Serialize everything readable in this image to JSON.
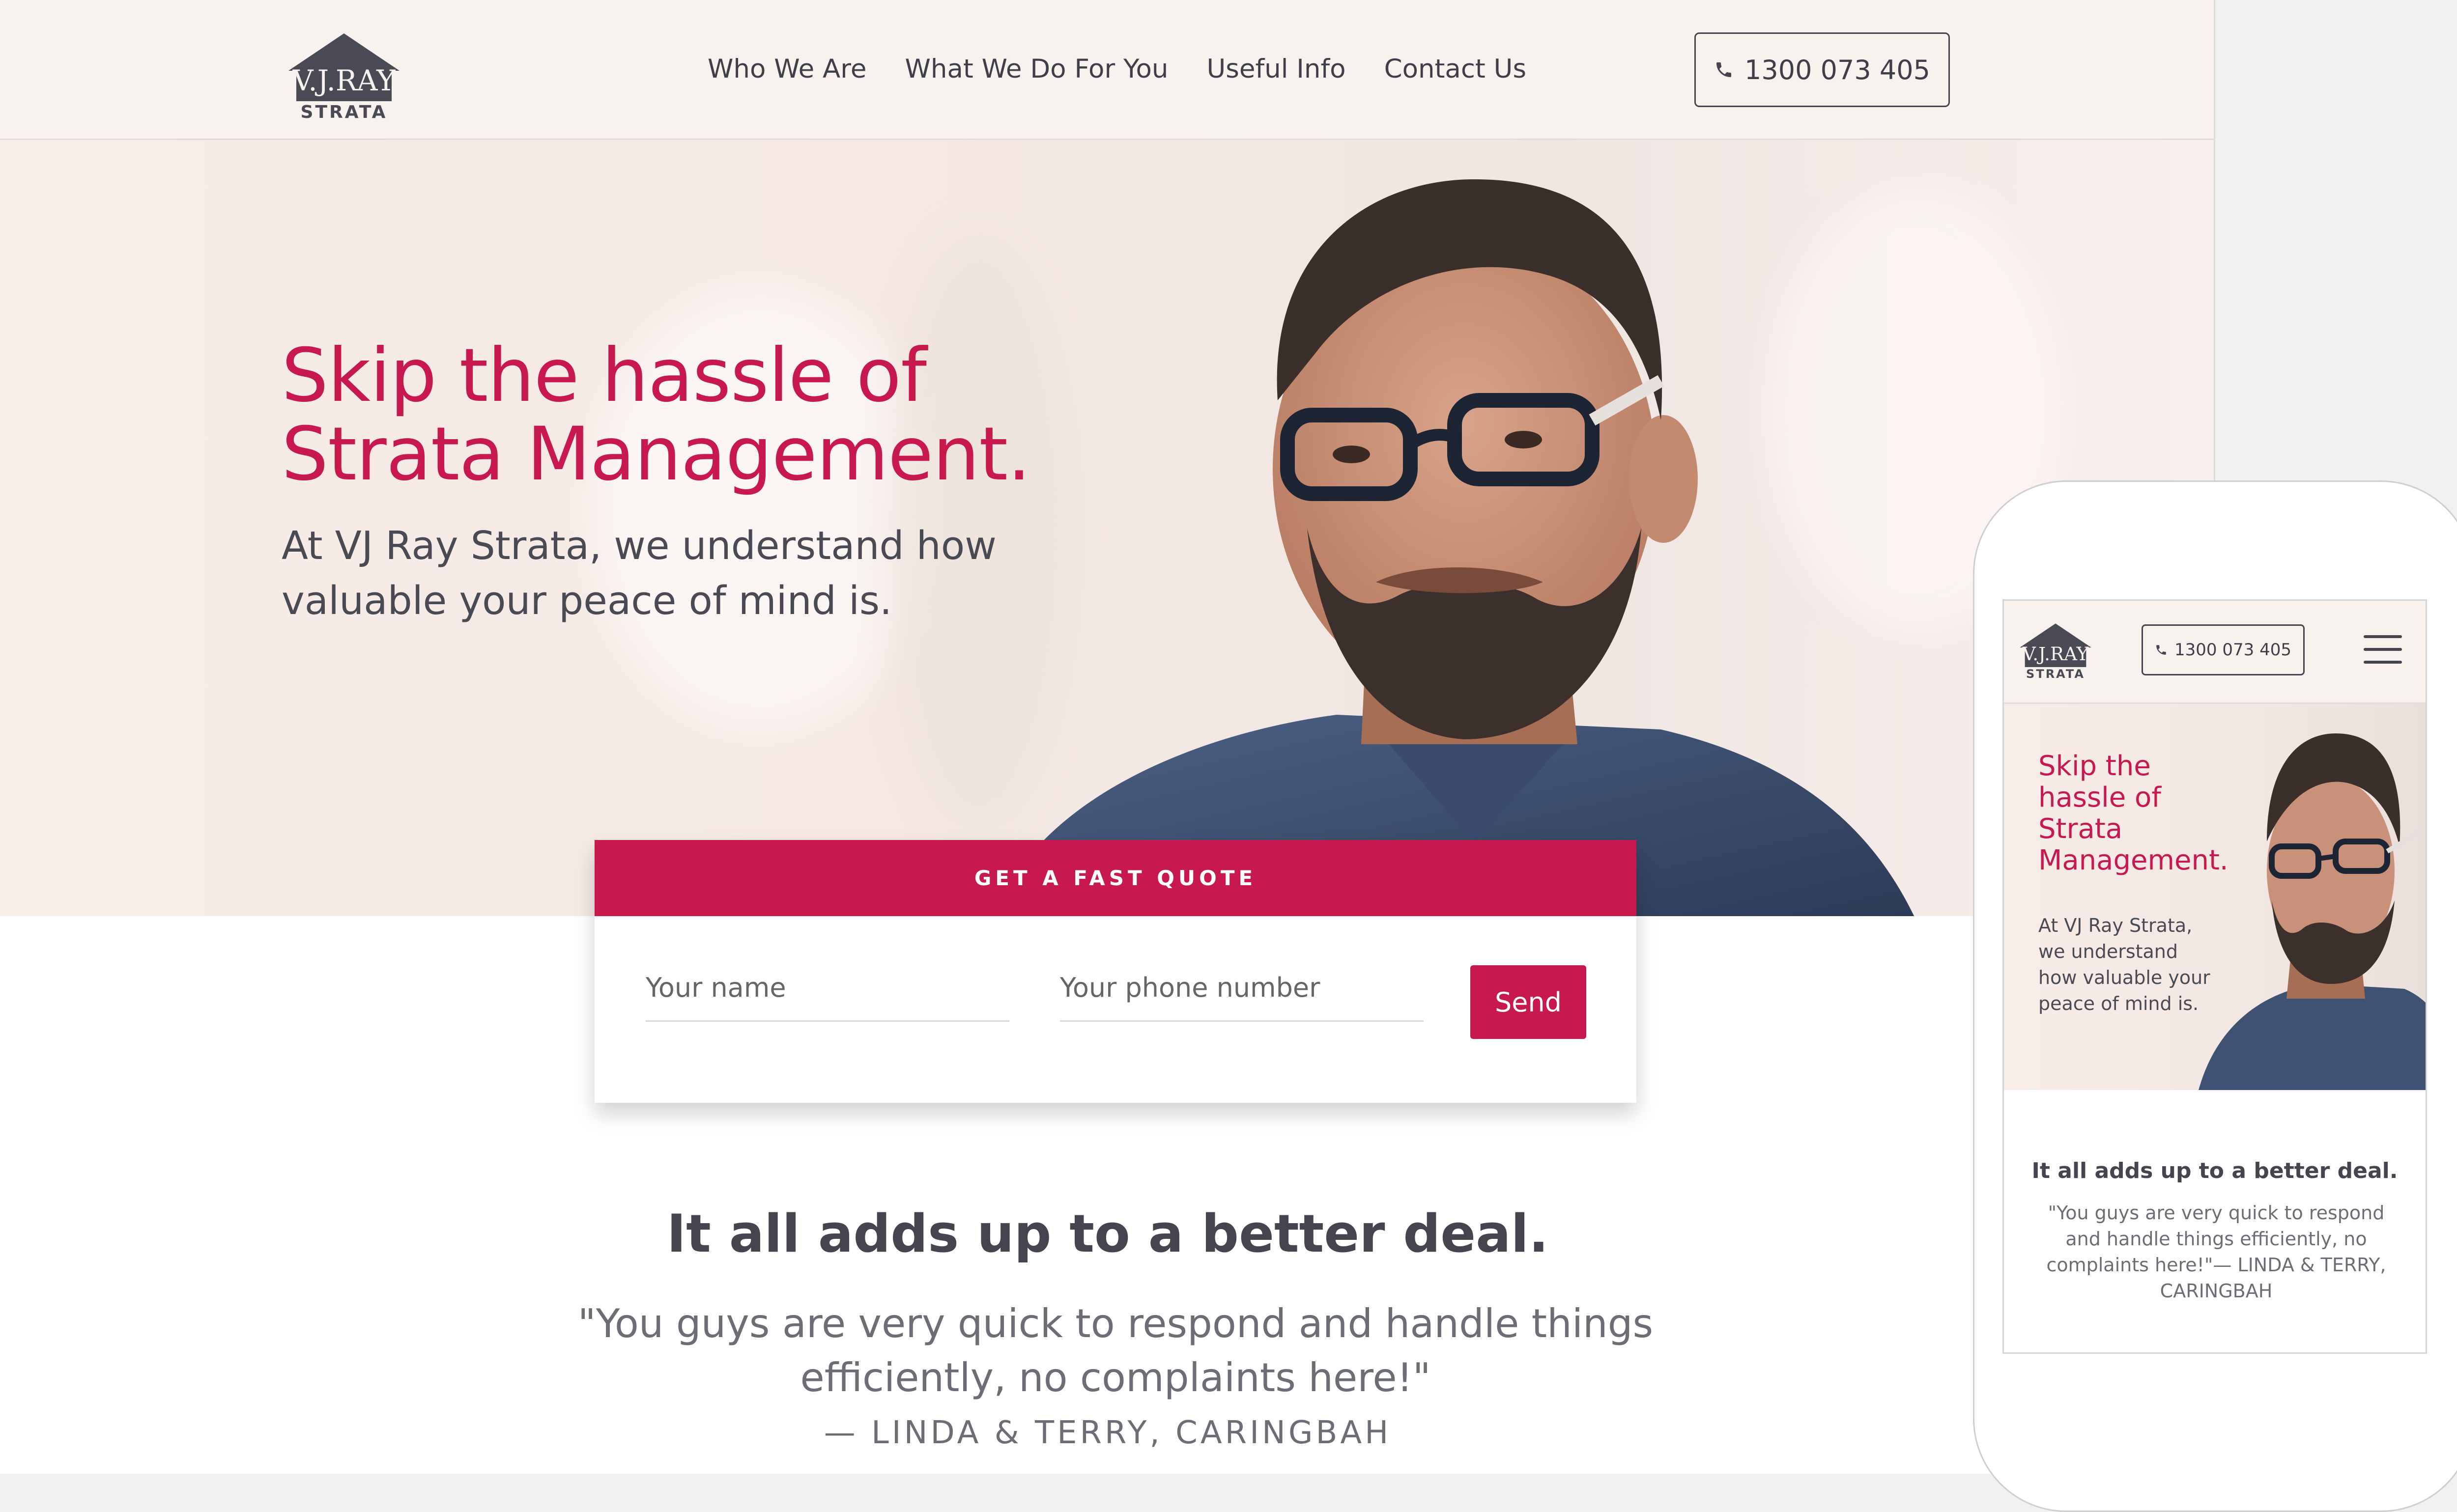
{
  "brand": {
    "logo_top": "V.J.RAY",
    "logo_bottom": "STRATA",
    "accent": "#c8194e",
    "text": "#45454f"
  },
  "nav": {
    "items": [
      {
        "label": "Who We Are"
      },
      {
        "label": "What We Do For You"
      },
      {
        "label": "Useful Info"
      },
      {
        "label": "Contact Us"
      }
    ],
    "phone": "1300 073 405",
    "phone_icon": "phone-icon"
  },
  "hero": {
    "title_line1": "Skip the hassle of",
    "title_line2": "Strata Management.",
    "subtitle": "At VJ Ray Strata, we understand how valuable your peace of mind is."
  },
  "quote_form": {
    "header": "GET A FAST QUOTE",
    "name_placeholder": "Your name",
    "phone_placeholder": "Your phone number",
    "send_label": "Send"
  },
  "deal": {
    "title": "It all adds up to a better deal.",
    "testimonial": "\"You guys are very quick to respond and handle things efficiently, no complaints here!\"",
    "attribution": "— LINDA & TERRY, CARINGBAH"
  },
  "mobile": {
    "phone": "1300 073 405",
    "menu_icon": "hamburger-menu-icon",
    "title_line1": "Skip the",
    "title_line2": "hassle of",
    "title_line3": "Strata",
    "title_line4": "Management.",
    "subtitle": "At VJ Ray Strata, we understand how valuable your peace of mind is.",
    "deal_title": "It all adds up to a better deal.",
    "testimonial": "\"You guys are very quick to respond and handle things efficiently, no complaints here!\"— LINDA & TERRY, CARINGBAH"
  }
}
